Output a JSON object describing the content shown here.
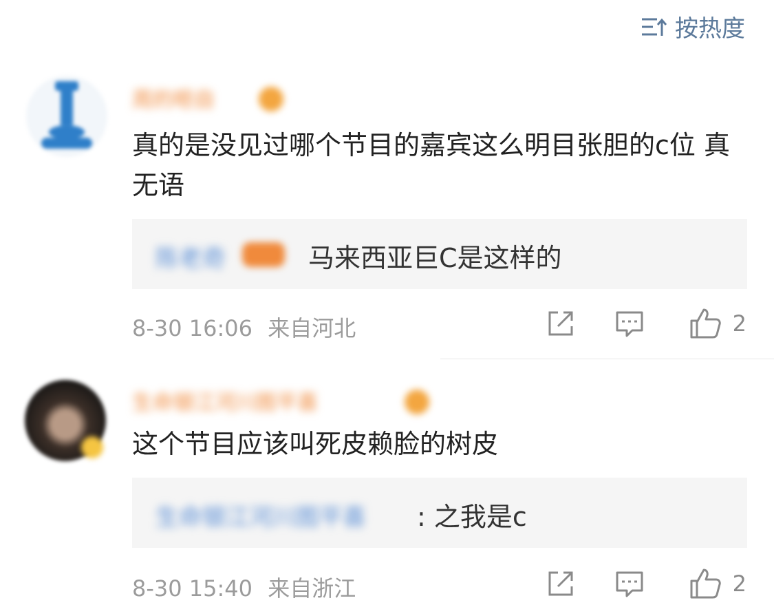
{
  "sort": {
    "label": "按热度",
    "icon": "sort-icon"
  },
  "comments": [
    {
      "text": "真的是没见过哪个节目的嘉宾这么明目张胆的c位 真无语",
      "username": "周的咂自",
      "reply": {
        "username": "陈老奇",
        "text": "马来西亚巨C是这样的"
      },
      "time": "8-30 16:06",
      "location": "来自河北",
      "likes": "2"
    },
    {
      "text": "这个节目应该叫死皮赖脸的树皮",
      "username": "生命银江河川图平喜",
      "reply": {
        "username": "生命银江河川图平喜",
        "text": ": 之我是c"
      },
      "time": "8-30 15:40",
      "location": "来自浙江",
      "likes": "2"
    }
  ],
  "colors": {
    "accent": "#5c7a9b",
    "username": "#f08a3c",
    "reply_name": "#5b8fd6",
    "meta": "#9b9b9b",
    "reply_bg": "#f5f5f5"
  }
}
